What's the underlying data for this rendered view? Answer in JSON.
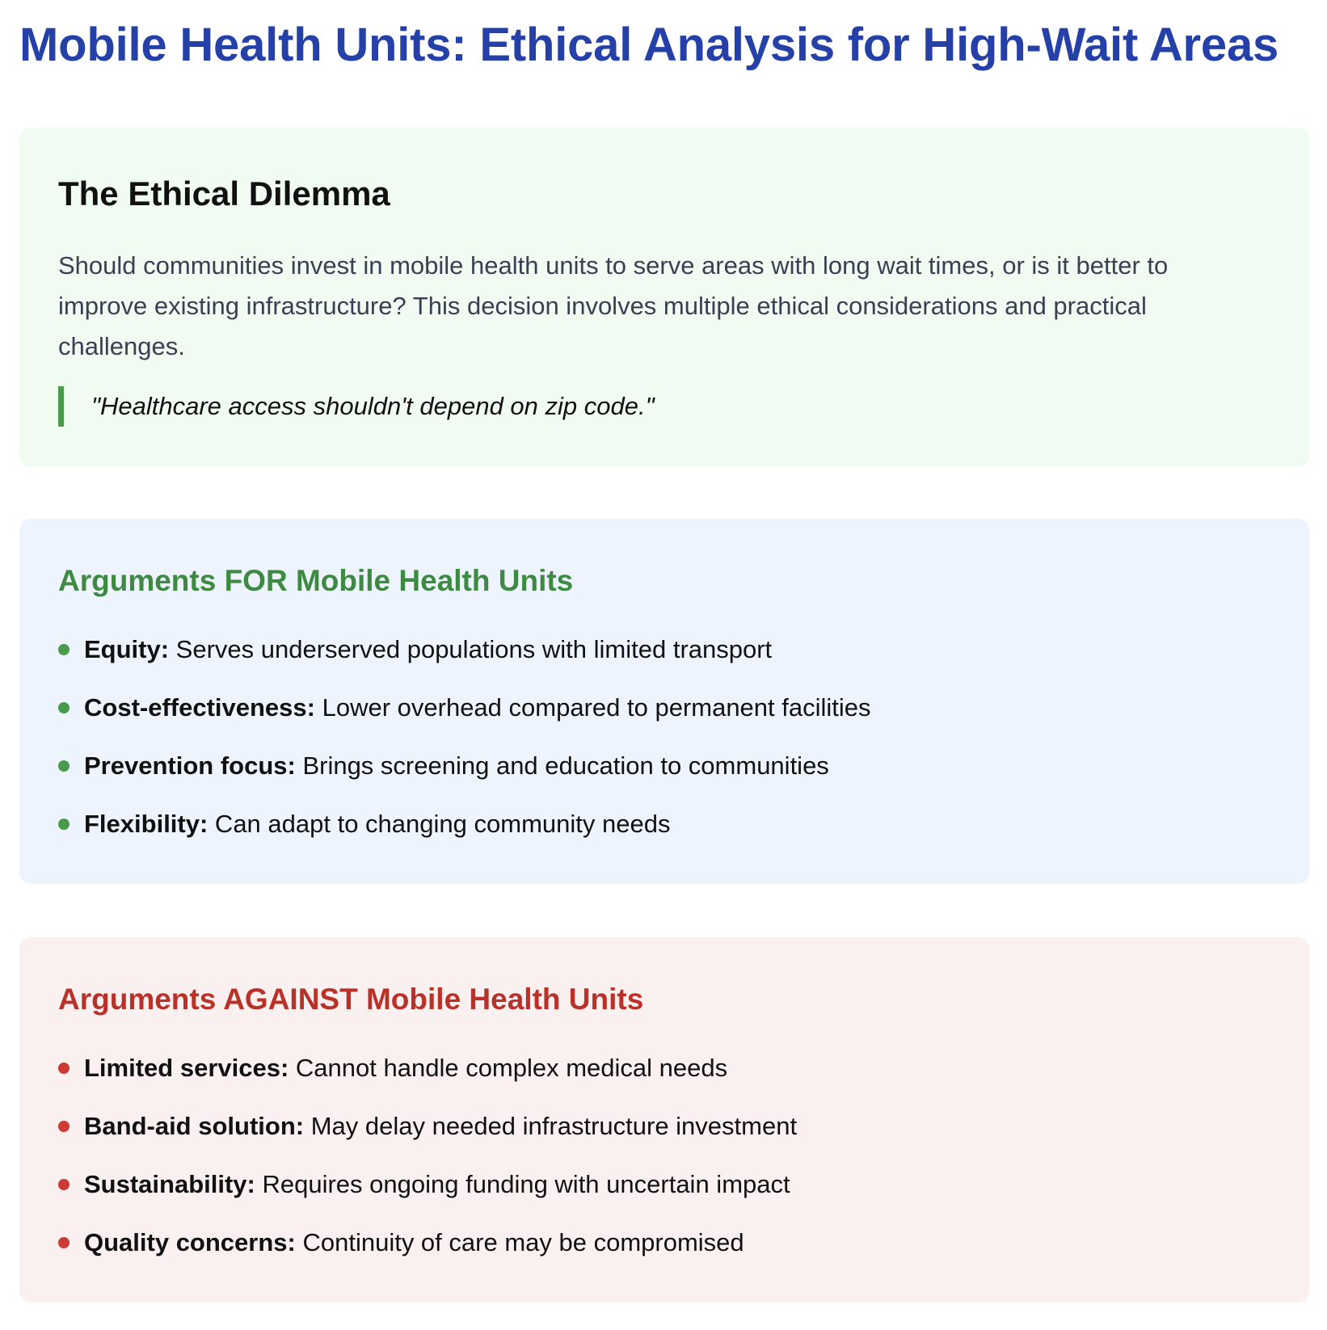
{
  "title": "Mobile Health Units: Ethical Analysis for High-Wait Areas",
  "dilemma": {
    "heading": "The Ethical Dilemma",
    "text": "Should communities invest in mobile health units to serve areas with long wait times, or is it better to improve existing infrastructure? This decision involves multiple ethical considerations and practical challenges.",
    "quote": "\"Healthcare access shouldn't depend on zip code.\""
  },
  "for": {
    "heading": "Arguments FOR Mobile Health Units",
    "items": [
      {
        "label": "Equity:",
        "text": " Serves underserved populations with limited transport"
      },
      {
        "label": "Cost-effectiveness:",
        "text": " Lower overhead compared to permanent facilities"
      },
      {
        "label": "Prevention focus:",
        "text": " Brings screening and education to communities"
      },
      {
        "label": "Flexibility:",
        "text": " Can adapt to changing community needs"
      }
    ]
  },
  "against": {
    "heading": "Arguments AGAINST Mobile Health Units",
    "items": [
      {
        "label": "Limited services:",
        "text": " Cannot handle complex medical needs"
      },
      {
        "label": "Band-aid solution:",
        "text": " May delay needed infrastructure investment"
      },
      {
        "label": "Sustainability:",
        "text": " Requires ongoing funding with uncertain impact"
      },
      {
        "label": "Quality concerns:",
        "text": " Continuity of care may be compromised"
      }
    ]
  },
  "colors": {
    "title": "#2541a8",
    "for_accent": "#3e8a42",
    "against_accent": "#b83229",
    "dilemma_bg": "#f0fbf2",
    "for_bg": "#edf4fe",
    "against_bg": "#fbf0f0"
  }
}
